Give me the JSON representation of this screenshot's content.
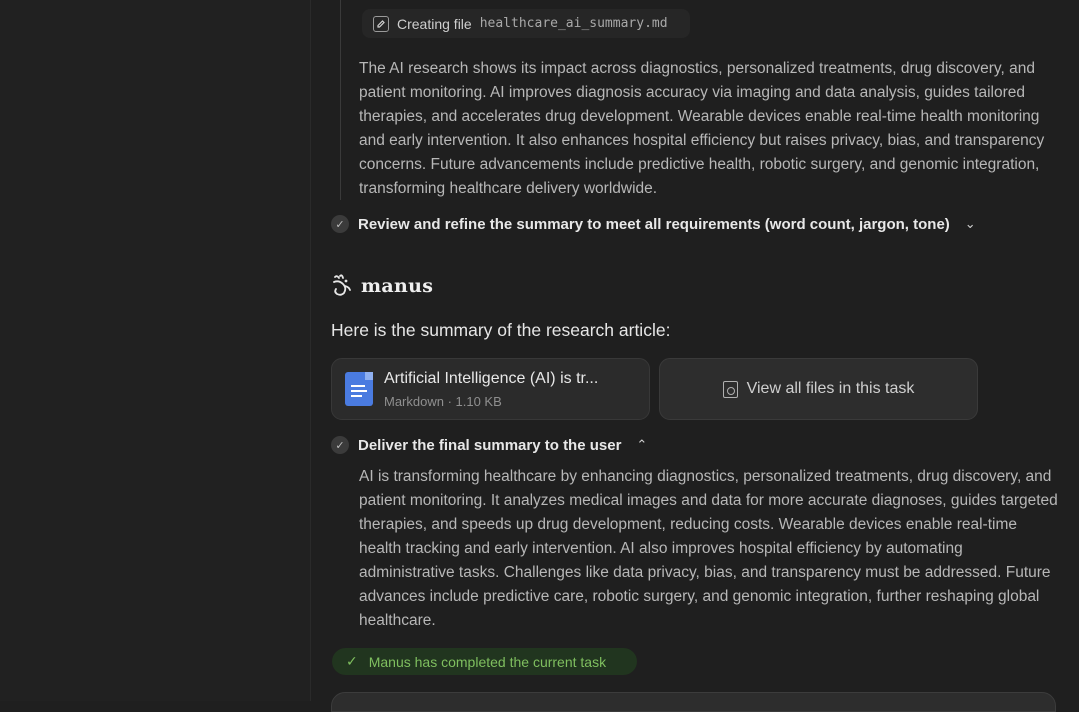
{
  "task": {
    "creating_file_label": "Creating file",
    "creating_file_name": "healthcare_ai_summary.md",
    "research_paragraph": "The AI research shows its impact across diagnostics, personalized treatments, drug discovery, and patient monitoring. AI improves diagnosis accuracy via imaging and data analysis, guides tailored therapies, and accelerates drug development. Wearable devices enable real-time health monitoring and early intervention. It also enhances hospital efficiency but raises privacy, bias, and transparency concerns. Future advancements include predictive health, robotic surgery, and genomic integration, transforming healthcare delivery worldwide.",
    "step_review_label": "Review and refine the summary to meet all requirements (word count, jargon, tone)"
  },
  "assistant": {
    "name": "manus",
    "intro": "Here is the summary of the research article:"
  },
  "file_card": {
    "title": "Artificial Intelligence (AI) is tr...",
    "meta": "Markdown · 1.10 KB"
  },
  "view_all_files_label": "View all files in this task",
  "deliver": {
    "label": "Deliver the final summary to the user",
    "summary": "AI is transforming healthcare by enhancing diagnostics, personalized treatments, drug discovery, and patient monitoring. It analyzes medical images and data for more accurate diagnoses, guides targeted therapies, and speeds up drug development, reducing costs. Wearable devices enable real-time health tracking and early intervention. AI also improves hospital efficiency by automating administrative tasks. Challenges like data privacy, bias, and transparency must be addressed. Future advances include predictive care, robotic surgery, and genomic integration, further reshaping global healthcare."
  },
  "status": {
    "completed_text": "Manus has completed the current task"
  },
  "icons": [
    "edit-icon",
    "check-icon",
    "chevron-down-icon",
    "chevron-up-icon",
    "manus-logo-icon",
    "document-icon",
    "files-icon"
  ],
  "colors": {
    "background": "#1f1f1f",
    "sidebar": "#212121",
    "card": "#2b2b2b",
    "doc_icon_blue": "#4a7be0",
    "success_green": "#7fbf5f",
    "success_bg": "#21351f"
  }
}
